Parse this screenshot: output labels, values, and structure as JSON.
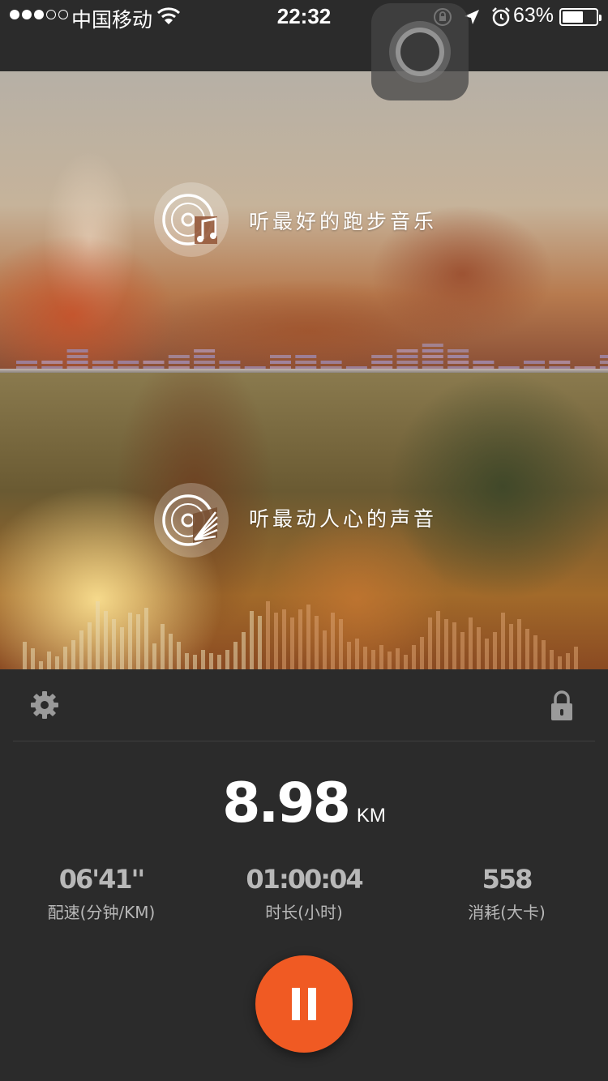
{
  "status_bar": {
    "carrier": "中国移动",
    "time": "22:32",
    "battery_percent": "63%",
    "battery_level": 0.63,
    "signal_bars_filled": 3,
    "signal_bars_total": 5
  },
  "banners": [
    {
      "title": "听最好的跑步音乐",
      "icon": "music-disc-note-icon"
    },
    {
      "title": "听最动人心的声音",
      "icon": "music-disc-fan-icon"
    }
  ],
  "toolbar": {
    "settings_icon": "gear-icon",
    "lock_icon": "lock-icon"
  },
  "distance": {
    "value": "8.98",
    "unit": "KM"
  },
  "stats": [
    {
      "value": "06'41''",
      "label": "配速(分钟/KM)"
    },
    {
      "value": "01:00:04",
      "label": "时长(小时)"
    },
    {
      "value": "558",
      "label": "消耗(大卡)"
    }
  ],
  "colors": {
    "accent": "#f05a23",
    "panel_bg": "#2b2b2b",
    "stat_text": "#b8b8b8"
  }
}
